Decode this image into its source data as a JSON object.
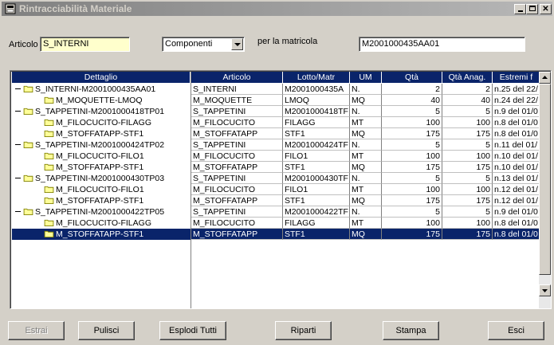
{
  "window": {
    "title": "Rintracciabilità Materiale"
  },
  "filters": {
    "articolo_label": "Articolo",
    "articolo_value": "S_INTERNI",
    "combo_value": "Componenti",
    "matricola_label": "per la matricola",
    "matricola_value": "M2001000435AA01"
  },
  "tree": {
    "header": "Dettaglio",
    "items": [
      {
        "label": "S_INTERNI-M2001000435AA01",
        "level": 0,
        "expanded": true,
        "selected": false
      },
      {
        "label": "M_MOQUETTE-LMOQ",
        "level": 1,
        "expanded": false,
        "selected": false
      },
      {
        "label": "S_TAPPETINI-M2001000418TP01",
        "level": 0,
        "expanded": true,
        "selected": false
      },
      {
        "label": "M_FILOCUCITO-FILAGG",
        "level": 1,
        "expanded": false,
        "selected": false
      },
      {
        "label": "M_STOFFATAPP-STF1",
        "level": 1,
        "expanded": false,
        "selected": false
      },
      {
        "label": "S_TAPPETINI-M2001000424TP02",
        "level": 0,
        "expanded": true,
        "selected": false
      },
      {
        "label": "M_FILOCUCITO-FILO1",
        "level": 1,
        "expanded": false,
        "selected": false
      },
      {
        "label": "M_STOFFATAPP-STF1",
        "level": 1,
        "expanded": false,
        "selected": false
      },
      {
        "label": "S_TAPPETINI-M2001000430TP03",
        "level": 0,
        "expanded": true,
        "selected": false
      },
      {
        "label": "M_FILOCUCITO-FILO1",
        "level": 1,
        "expanded": false,
        "selected": false
      },
      {
        "label": "M_STOFFATAPP-STF1",
        "level": 1,
        "expanded": false,
        "selected": false
      },
      {
        "label": "S_TAPPETINI-M2001000422TP05",
        "level": 0,
        "expanded": true,
        "selected": false
      },
      {
        "label": "M_FILOCUCITO-FILAGG",
        "level": 1,
        "expanded": false,
        "selected": false
      },
      {
        "label": "M_STOFFATAPP-STF1",
        "level": 1,
        "expanded": false,
        "selected": true
      }
    ]
  },
  "table": {
    "columns": [
      "Articolo",
      "Lotto/Matr",
      "UM",
      "Qtà",
      "Qtà Anag.",
      "Estremi f"
    ],
    "rows": [
      [
        "S_INTERNI",
        "M2001000435A",
        "N.",
        "2",
        "2",
        "n.25 del 22/"
      ],
      [
        "M_MOQUETTE",
        "LMOQ",
        "MQ",
        "40",
        "40",
        "n.24 del 22/"
      ],
      [
        "S_TAPPETINI",
        "M2001000418TF",
        "N.",
        "5",
        "5",
        "n.9 del 01/0"
      ],
      [
        "M_FILOCUCITO",
        "FILAGG",
        "MT",
        "100",
        "100",
        "n.8 del 01/0"
      ],
      [
        "M_STOFFATAPP",
        "STF1",
        "MQ",
        "175",
        "175",
        "n.8 del 01/0"
      ],
      [
        "S_TAPPETINI",
        "M2001000424TF",
        "N.",
        "5",
        "5",
        "n.11 del 01/"
      ],
      [
        "M_FILOCUCITO",
        "FILO1",
        "MT",
        "100",
        "100",
        "n.10 del 01/"
      ],
      [
        "M_STOFFATAPP",
        "STF1",
        "MQ",
        "175",
        "175",
        "n.10 del 01/"
      ],
      [
        "S_TAPPETINI",
        "M2001000430TF",
        "N.",
        "5",
        "5",
        "n.13 del 01/"
      ],
      [
        "M_FILOCUCITO",
        "FILO1",
        "MT",
        "100",
        "100",
        "n.12 del 01/"
      ],
      [
        "M_STOFFATAPP",
        "STF1",
        "MQ",
        "175",
        "175",
        "n.12 del 01/"
      ],
      [
        "S_TAPPETINI",
        "M2001000422TF",
        "N.",
        "5",
        "5",
        "n.9 del 01/0"
      ],
      [
        "M_FILOCUCITO",
        "FILAGG",
        "MT",
        "100",
        "100",
        "n.8 del 01/0"
      ],
      [
        "M_STOFFATAPP",
        "STF1",
        "MQ",
        "175",
        "175",
        "n.8 del 01/0"
      ]
    ],
    "selected_row": 13
  },
  "buttons": {
    "estrai": "Estrai",
    "pulisci": "Pulisci",
    "esplodi": "Esplodi Tutti",
    "riparti": "Riparti",
    "stampa": "Stampa",
    "esci": "Esci"
  },
  "colors": {
    "selection": "#0a246a",
    "face": "#d4d0c8",
    "folder": "#ffff99"
  }
}
